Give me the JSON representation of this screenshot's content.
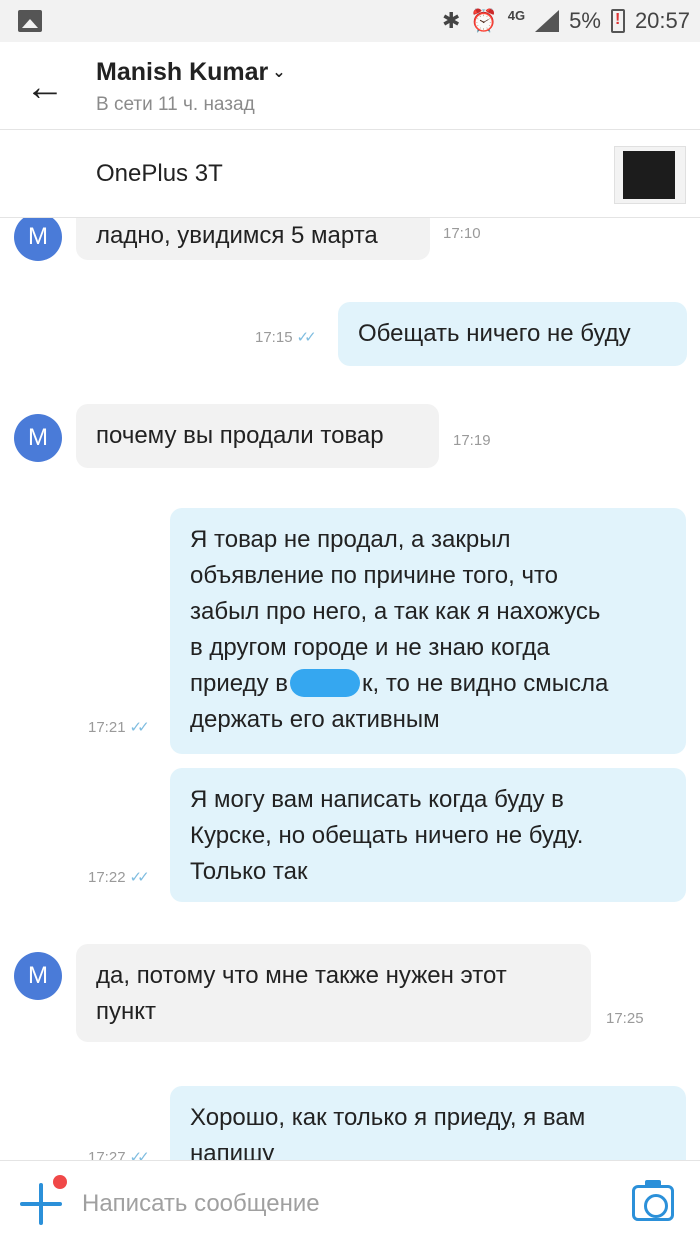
{
  "status_bar": {
    "network": "4G",
    "battery": "5%",
    "time": "20:57",
    "icons": [
      "image-icon",
      "bluetooth-icon",
      "alarm-icon",
      "signal-icon",
      "battery-icon"
    ]
  },
  "header": {
    "back_icon": "←",
    "contact_name": "Manish Kumar",
    "chevron": "⌄",
    "last_seen": "В сети 11 ч. назад"
  },
  "item": {
    "title": "OnePlus 3T"
  },
  "messages": [
    {
      "direction": "in",
      "avatar": "M",
      "text": "ладно, увидимся 5 марта",
      "time": "17:10"
    },
    {
      "direction": "out",
      "text": "Обещать ничего не буду",
      "time": "17:15",
      "ticks": "✓✓"
    },
    {
      "direction": "in",
      "avatar": "M",
      "text": "почему вы продали товар",
      "time": "17:19"
    },
    {
      "direction": "out",
      "text_lines": [
        "Я товар не продал, а закрыл",
        "объявление по причине того, что",
        "забыл про него, а так как я нахожусь",
        "в другом городе и не знаю когда"
      ],
      "text_before_redaction": "приеду в",
      "text_after_redaction": "к, то не видно смысла",
      "text_last_line": "держать его активным",
      "time": "17:21",
      "ticks": "✓✓"
    },
    {
      "direction": "out",
      "text_lines": [
        "Я могу вам написать когда буду в",
        "Курске, но обещать ничего не буду.",
        "Только так"
      ],
      "time": "17:22",
      "ticks": "✓✓"
    },
    {
      "direction": "in",
      "avatar": "M",
      "text_lines": [
        "да, потому что мне также нужен этот",
        "пункт"
      ],
      "time": "17:25"
    },
    {
      "direction": "out",
      "text_lines": [
        "Хорошо, как только я приеду, я вам",
        "напишу"
      ],
      "time": "17:27",
      "ticks": "✓✓"
    }
  ],
  "composer": {
    "placeholder": "Написать сообщение"
  },
  "colors": {
    "accent": "#2b90d9",
    "avatar": "#4a7bd8",
    "incoming_bubble": "#f2f2f2",
    "outgoing_bubble": "#e1f3fb",
    "ticks": "#7fbde0",
    "notification_dot": "#f04848"
  }
}
